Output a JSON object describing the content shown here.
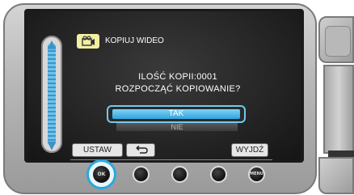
{
  "dialog": {
    "mode_icon": "video-camera-icon",
    "title": "KOPIUJ WIDEO",
    "line1": "ILOŚĆ KOPII:0001",
    "line2": "ROZPOCZĄĆ KOPIOWANIE?",
    "option_yes": "TAK",
    "option_no": "NIE"
  },
  "softkeys": {
    "left": "USTAW",
    "back_icon": "return-arrow-icon",
    "right": "WYJDŹ"
  },
  "buttons": {
    "ok_label": "OK",
    "menu_label": "MENU"
  },
  "colors": {
    "accent": "#31a4dc",
    "mode_icon_bg": "#f2f0a0"
  }
}
